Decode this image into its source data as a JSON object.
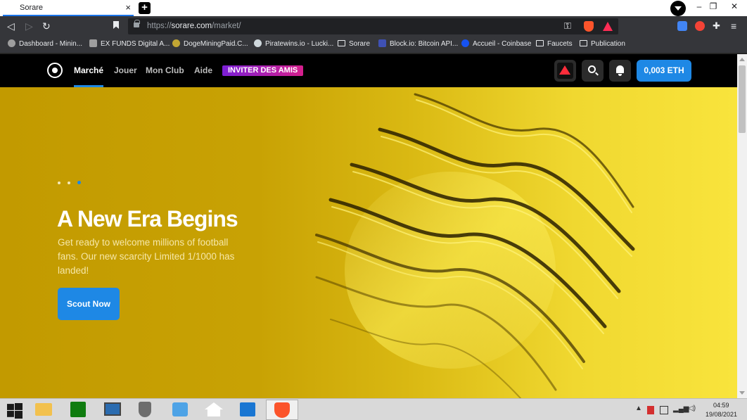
{
  "browser": {
    "tab_title": "Sorare",
    "tab_close": "×",
    "new_tab": "+",
    "url_scheme": "https://",
    "url_host": "sorare.com",
    "url_path": "/market/",
    "window_controls": {
      "minimize": "–",
      "restore": "❐",
      "close": "✕"
    },
    "nav": {
      "back": "◁",
      "forward": "▷",
      "reload": "↻"
    },
    "menu": "≡",
    "bookmarks": [
      {
        "label": "Dashboard - Minin...",
        "icon": "dashboard-icon",
        "color": "#9e9e9e"
      },
      {
        "label": "EX FUNDS Digital A...",
        "icon": "exfunds-icon",
        "color": "#9e9e9e"
      },
      {
        "label": "DogeMiningPaid.C...",
        "icon": "doge-icon",
        "color": "#c2a633"
      },
      {
        "label": "Piratewins.io - Lucki...",
        "icon": "pirate-icon",
        "color": "#cfd8dc"
      },
      {
        "label": "Sorare",
        "icon": "folder-icon",
        "color": ""
      },
      {
        "label": "Block.io: Bitcoin API...",
        "icon": "blockio-icon",
        "color": "#3f51b5"
      },
      {
        "label": "Accueil - Coinbase",
        "icon": "coinbase-icon",
        "color": "#1652f0"
      },
      {
        "label": "Faucets",
        "icon": "folder-icon",
        "color": ""
      },
      {
        "label": "Publication",
        "icon": "folder-icon",
        "color": ""
      }
    ]
  },
  "site": {
    "nav": [
      {
        "label": "Marché",
        "active": true
      },
      {
        "label": "Jouer",
        "active": false
      },
      {
        "label": "Mon Club",
        "active": false
      },
      {
        "label": "Aide",
        "active": false
      }
    ],
    "invite_label": "INVITER DES AMIS",
    "balance_label": "0,003 ETH"
  },
  "hero": {
    "title": "A New Era Begins",
    "text": "Get ready to welcome millions of football fans. Our new scarcity Limited 1/1000 has landed!",
    "cta_label": "Scout Now",
    "slides_total": 3,
    "active_slide": 3
  },
  "taskbar": {
    "time": "04:59",
    "date": "19/08/2021"
  },
  "colors": {
    "accent": "#1e88e5",
    "hero_gold": "#c29a00",
    "hero_yellow": "#f9e43c",
    "invite_start": "#7b1fd6",
    "invite_end": "#d61f8c"
  }
}
